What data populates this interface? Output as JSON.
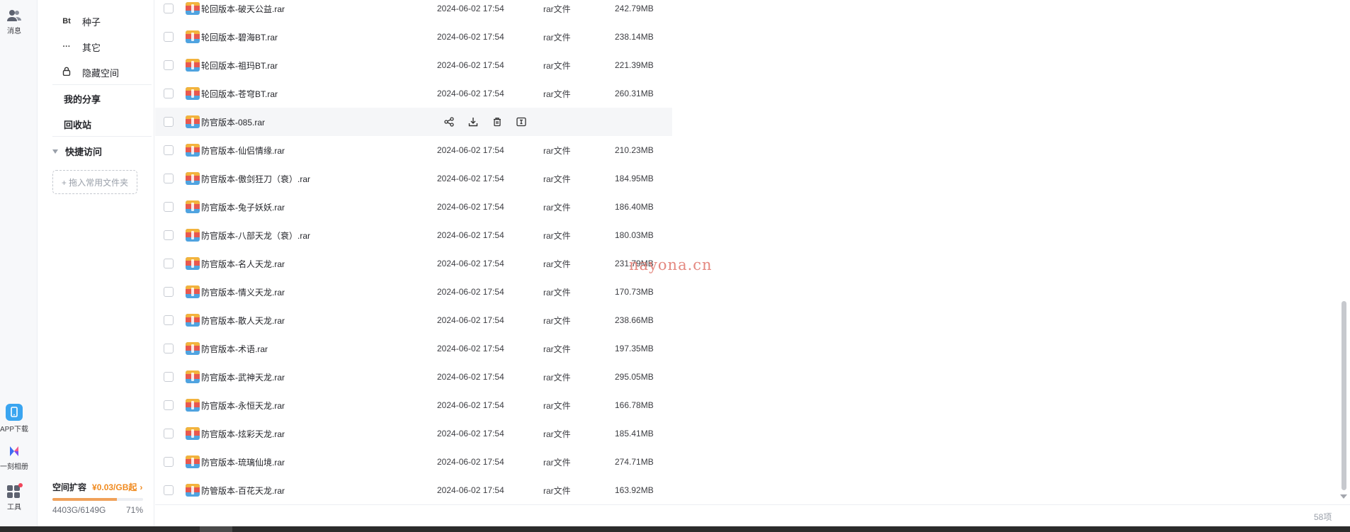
{
  "rail": {
    "messages_label": "消息",
    "app_download_label": "APP下载",
    "album_label": "一刻相册",
    "tools_label": "工具"
  },
  "nav": {
    "seed_icon": "Bt",
    "seed_label": "种子",
    "other_icon": "···",
    "other_label": "其它",
    "hidden_label": "隐藏空间",
    "share_label": "我的分享",
    "recycle_label": "回收站",
    "quick_access_label": "快捷访问",
    "drop_box_label": "+ 拖入常用文件夹",
    "storage": {
      "expand_label": "空间扩容",
      "price": "¥0.03/GB起",
      "used_text": "4403G/6149G",
      "percent_text": "71%",
      "percent": 71
    }
  },
  "files": [
    {
      "name": "轮回版本-破天公益.rar",
      "date": "2024-06-02 17:54",
      "type": "rar文件",
      "size": "242.79MB"
    },
    {
      "name": "轮回版本-碧海BT.rar",
      "date": "2024-06-02 17:54",
      "type": "rar文件",
      "size": "238.14MB"
    },
    {
      "name": "轮回版本-祖玛BT.rar",
      "date": "2024-06-02 17:54",
      "type": "rar文件",
      "size": "221.39MB"
    },
    {
      "name": "轮回版本-苍穹BT.rar",
      "date": "2024-06-02 17:54",
      "type": "rar文件",
      "size": "260.31MB"
    },
    {
      "name": "防官版本-085.rar",
      "date": "",
      "type": "",
      "size": "",
      "hover": true
    },
    {
      "name": "防官版本-仙侣情缘.rar",
      "date": "2024-06-02 17:54",
      "type": "rar文件",
      "size": "210.23MB"
    },
    {
      "name": "防官版本-傲剑狂刀（衰）.rar",
      "date": "2024-06-02 17:54",
      "type": "rar文件",
      "size": "184.95MB"
    },
    {
      "name": "防官版本-兔子妖妖.rar",
      "date": "2024-06-02 17:54",
      "type": "rar文件",
      "size": "186.40MB"
    },
    {
      "name": "防官版本-八部天龙（衰）.rar",
      "date": "2024-06-02 17:54",
      "type": "rar文件",
      "size": "180.03MB"
    },
    {
      "name": "防官版本-名人天龙.rar",
      "date": "2024-06-02 17:54",
      "type": "rar文件",
      "size": "231.79MB"
    },
    {
      "name": "防官版本-情义天龙.rar",
      "date": "2024-06-02 17:54",
      "type": "rar文件",
      "size": "170.73MB"
    },
    {
      "name": "防官版本-散人天龙.rar",
      "date": "2024-06-02 17:54",
      "type": "rar文件",
      "size": "238.66MB"
    },
    {
      "name": "防官版本-术语.rar",
      "date": "2024-06-02 17:54",
      "type": "rar文件",
      "size": "197.35MB"
    },
    {
      "name": "防官版本-武神天龙.rar",
      "date": "2024-06-02 17:54",
      "type": "rar文件",
      "size": "295.05MB"
    },
    {
      "name": "防官版本-永恒天龙.rar",
      "date": "2024-06-02 17:54",
      "type": "rar文件",
      "size": "166.78MB"
    },
    {
      "name": "防官版本-炫彩天龙.rar",
      "date": "2024-06-02 17:54",
      "type": "rar文件",
      "size": "185.41MB"
    },
    {
      "name": "防官版本-琉璃仙境.rar",
      "date": "2024-06-02 17:54",
      "type": "rar文件",
      "size": "274.71MB"
    },
    {
      "name": "防管版本-百花天龙.rar",
      "date": "2024-06-02 17:54",
      "type": "rar文件",
      "size": "163.92MB"
    }
  ],
  "watermark": "nayona.cn",
  "item_count": "58项",
  "colors": {
    "accent_orange": "#f08a1f",
    "rar_icon_top": "#f3b33d",
    "rar_icon_mid": "#e8584f",
    "rar_icon_bottom": "#4fa3e0"
  }
}
